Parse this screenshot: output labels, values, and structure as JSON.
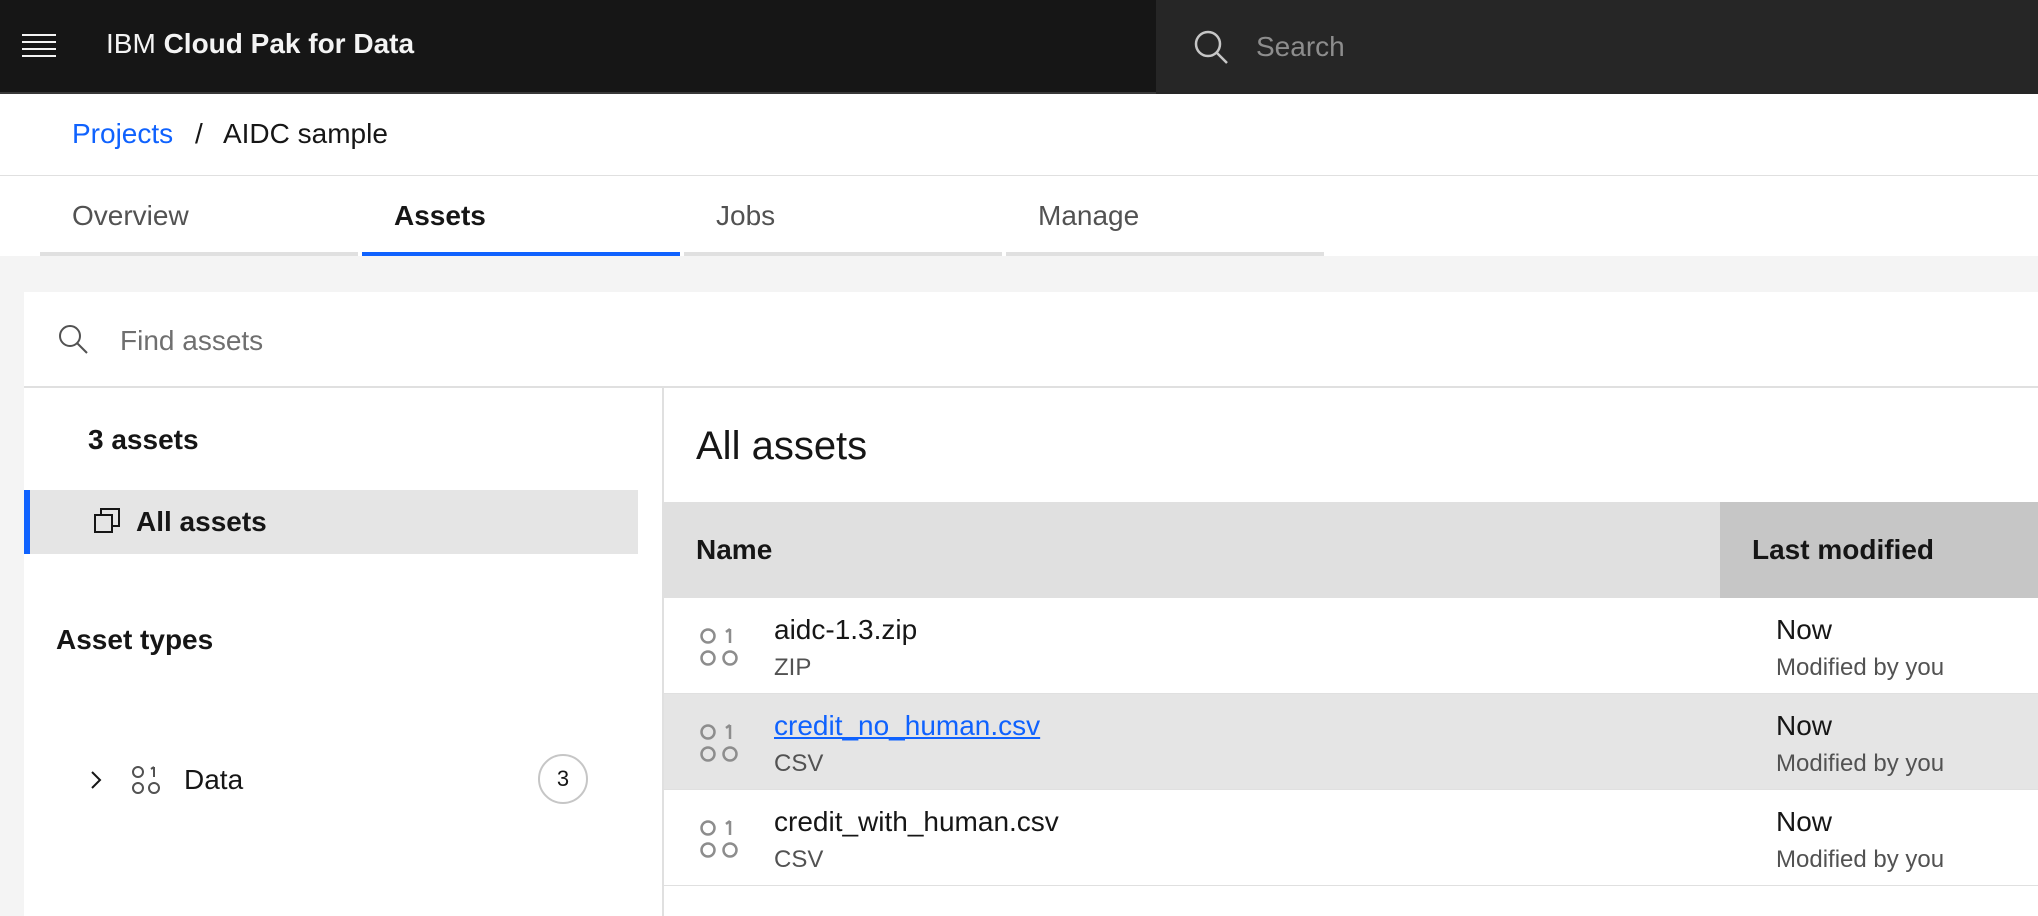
{
  "header": {
    "brand_prefix": "IBM",
    "brand_name": "Cloud Pak for Data",
    "search_placeholder": "Search",
    "menu_icon": "hamburger-menu-icon",
    "search_icon": "search-icon"
  },
  "breadcrumb": {
    "parent": "Projects",
    "separator": "/",
    "current": "AIDC sample"
  },
  "tabs": [
    {
      "label": "Overview",
      "active": false
    },
    {
      "label": "Assets",
      "active": true
    },
    {
      "label": "Jobs",
      "active": false
    },
    {
      "label": "Manage",
      "active": false
    }
  ],
  "find": {
    "placeholder": "Find assets"
  },
  "sidebar": {
    "count_label": "3 assets",
    "all_assets_label": "All assets",
    "types_heading": "Asset types",
    "types": [
      {
        "label": "Data",
        "count": "3",
        "icon": "data-asset-icon"
      }
    ]
  },
  "main": {
    "title": "All assets",
    "columns": {
      "name": "Name",
      "last_modified": "Last modified"
    },
    "rows": [
      {
        "name": "aidc-1.3.zip",
        "type": "ZIP",
        "when": "Now",
        "by": "Modified by you",
        "link": false,
        "hover": false
      },
      {
        "name": "credit_no_human.csv",
        "type": "CSV",
        "when": "Now",
        "by": "Modified by you",
        "link": true,
        "hover": true
      },
      {
        "name": "credit_with_human.csv",
        "type": "CSV",
        "when": "Now",
        "by": "Modified by you",
        "link": false,
        "hover": false
      }
    ]
  },
  "colors": {
    "accent": "#0f62fe",
    "header_bg": "#161616",
    "search_bg": "#262626"
  }
}
